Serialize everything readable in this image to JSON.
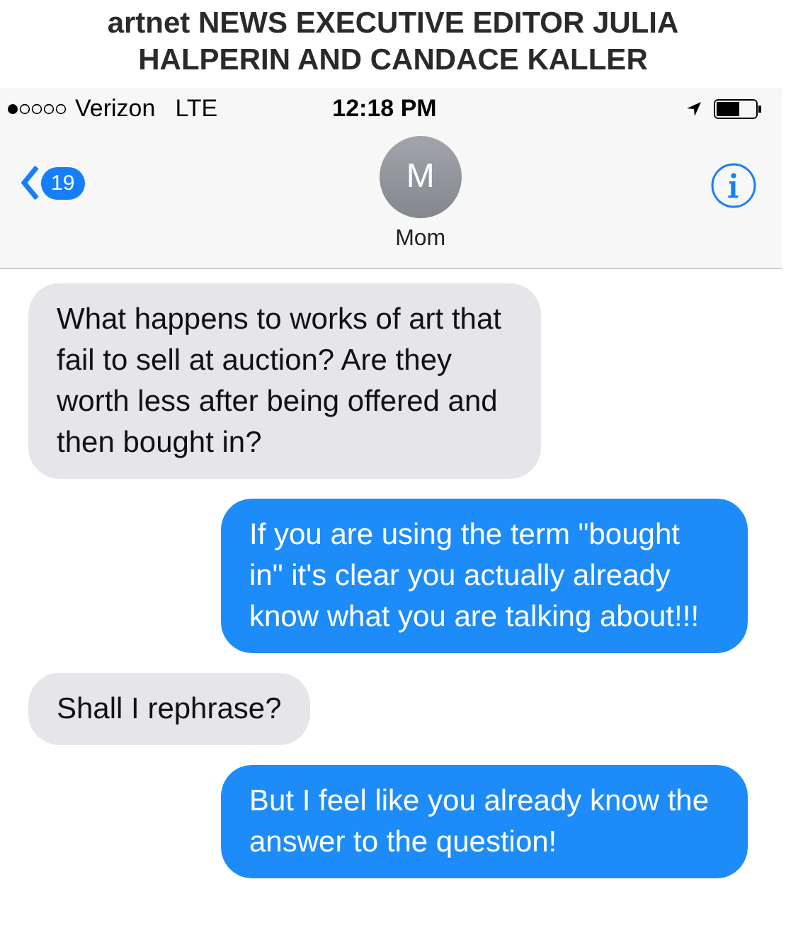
{
  "caption": "artnet NEWS EXECUTIVE EDITOR JULIA HALPERIN AND CANDACE KALLER",
  "status_bar": {
    "carrier": "Verizon",
    "network": "LTE",
    "time": "12:18 PM"
  },
  "nav": {
    "back_count": "19",
    "avatar_initial": "M",
    "contact": "Mom"
  },
  "messages": [
    {
      "kind": "received",
      "text": "What happens to works of art that fail to sell at auction? Are they worth less after being offered and then bought in?"
    },
    {
      "kind": "sent",
      "text": "If you are using the term \"bought in\" it's clear you actually already know what you are talking about!!!"
    },
    {
      "kind": "received",
      "text": "Shall I rephrase?"
    },
    {
      "kind": "sent",
      "text": "But I feel like you already know the answer to the question!"
    }
  ]
}
